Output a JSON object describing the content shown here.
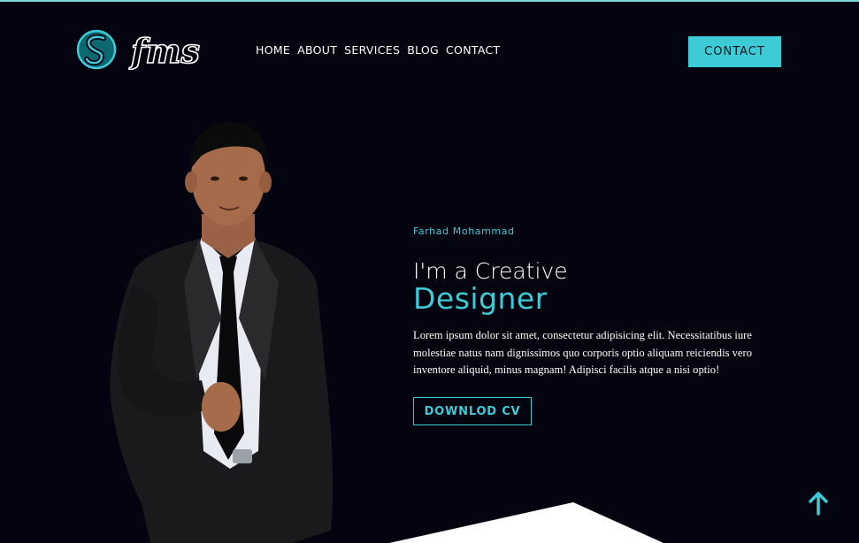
{
  "logo": {
    "icon": "s-swirl-logo-icon",
    "wordmark": "fms"
  },
  "nav": {
    "items": [
      "HOME",
      "ABOUT",
      "SERVICES",
      "BLOG",
      "CONTACT"
    ],
    "cta_label": "CONTACT"
  },
  "hero": {
    "subtitle": "Farhad Mohammad",
    "headline": "I'm a Creative",
    "headline_accent": "Designer",
    "intro": "Lorem ipsum dolor sit amet, consectetur adipisicing elit. Necessitatibus iure molestiae natus nam dignissimos quo corporis optio aliquam reiciendis vero inventore aliquid, minus magnam! Adipisci facilis atque a nisi optio!",
    "cv_label": "DOWNLOD CV"
  },
  "scroll_top": {
    "icon": "arrow-up-icon"
  },
  "colors": {
    "background": "#03040f",
    "accent": "#3dcbd6",
    "text": "#ffffff"
  }
}
